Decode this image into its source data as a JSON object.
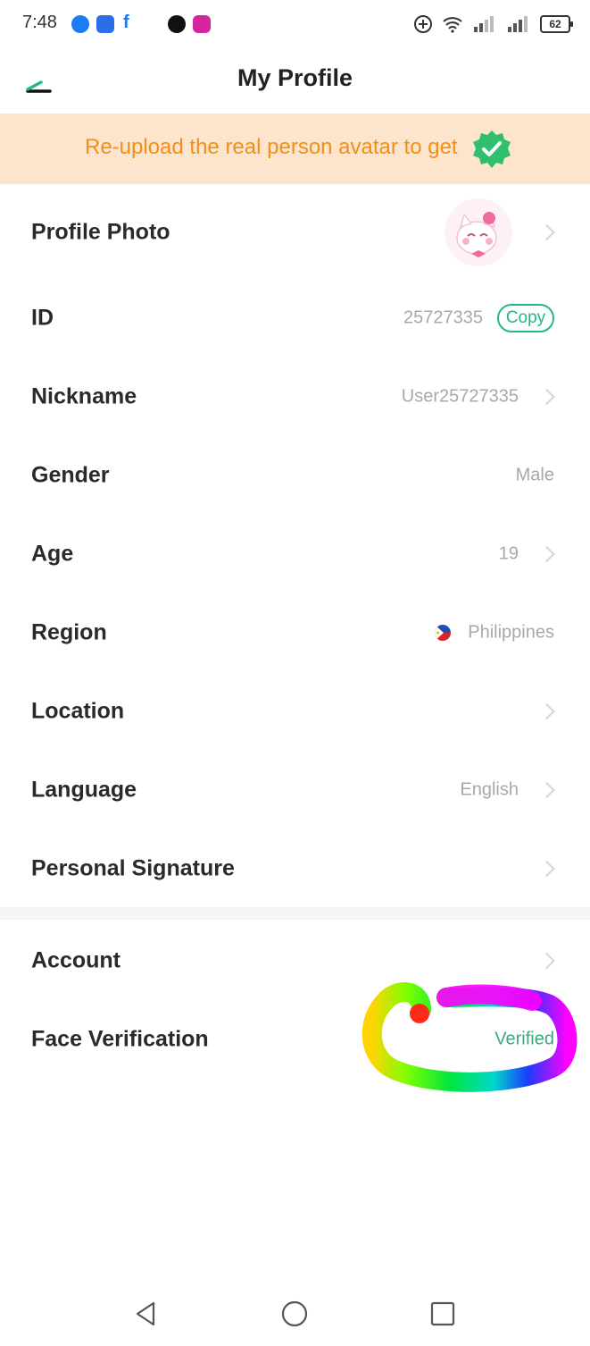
{
  "status_bar": {
    "time": "7:48",
    "app_icons": [
      "messenger-icon",
      "chat-icon",
      "facebook-icon",
      "tiktok-icon",
      "instagram-icon"
    ],
    "right_icons": [
      "add-circle-icon",
      "wifi-icon",
      "signal-icon",
      "signal-icon"
    ],
    "battery": "62"
  },
  "header": {
    "title": "My Profile",
    "back_icon": "back-icon"
  },
  "banner": {
    "text": "Re-upload the real person avatar to get",
    "badge_icon": "verified-badge-icon",
    "text_color": "#f0901a",
    "background": "#fde4cd"
  },
  "rows": [
    {
      "label": "Profile Photo",
      "value": "",
      "icon": "avatar"
    },
    {
      "label": "ID",
      "value": "25727335",
      "action": "Copy"
    },
    {
      "label": "Nickname",
      "value": "User25727335"
    },
    {
      "label": "Gender",
      "value": "Male"
    },
    {
      "label": "Age",
      "value": "19"
    },
    {
      "label": "Region",
      "value": "Philippines",
      "icon": "philippines-flag-icon"
    },
    {
      "label": "Location",
      "value": ""
    },
    {
      "label": "Language",
      "value": "English"
    },
    {
      "label": "Personal Signature",
      "value": ""
    }
  ],
  "account_rows": [
    {
      "label": "Account",
      "value": ""
    },
    {
      "label": "Face Verification",
      "value": "Verified"
    }
  ],
  "accent_color": "#22b88a",
  "nav_bar": [
    "back-triangle-icon",
    "home-circle-icon",
    "recents-square-icon"
  ]
}
